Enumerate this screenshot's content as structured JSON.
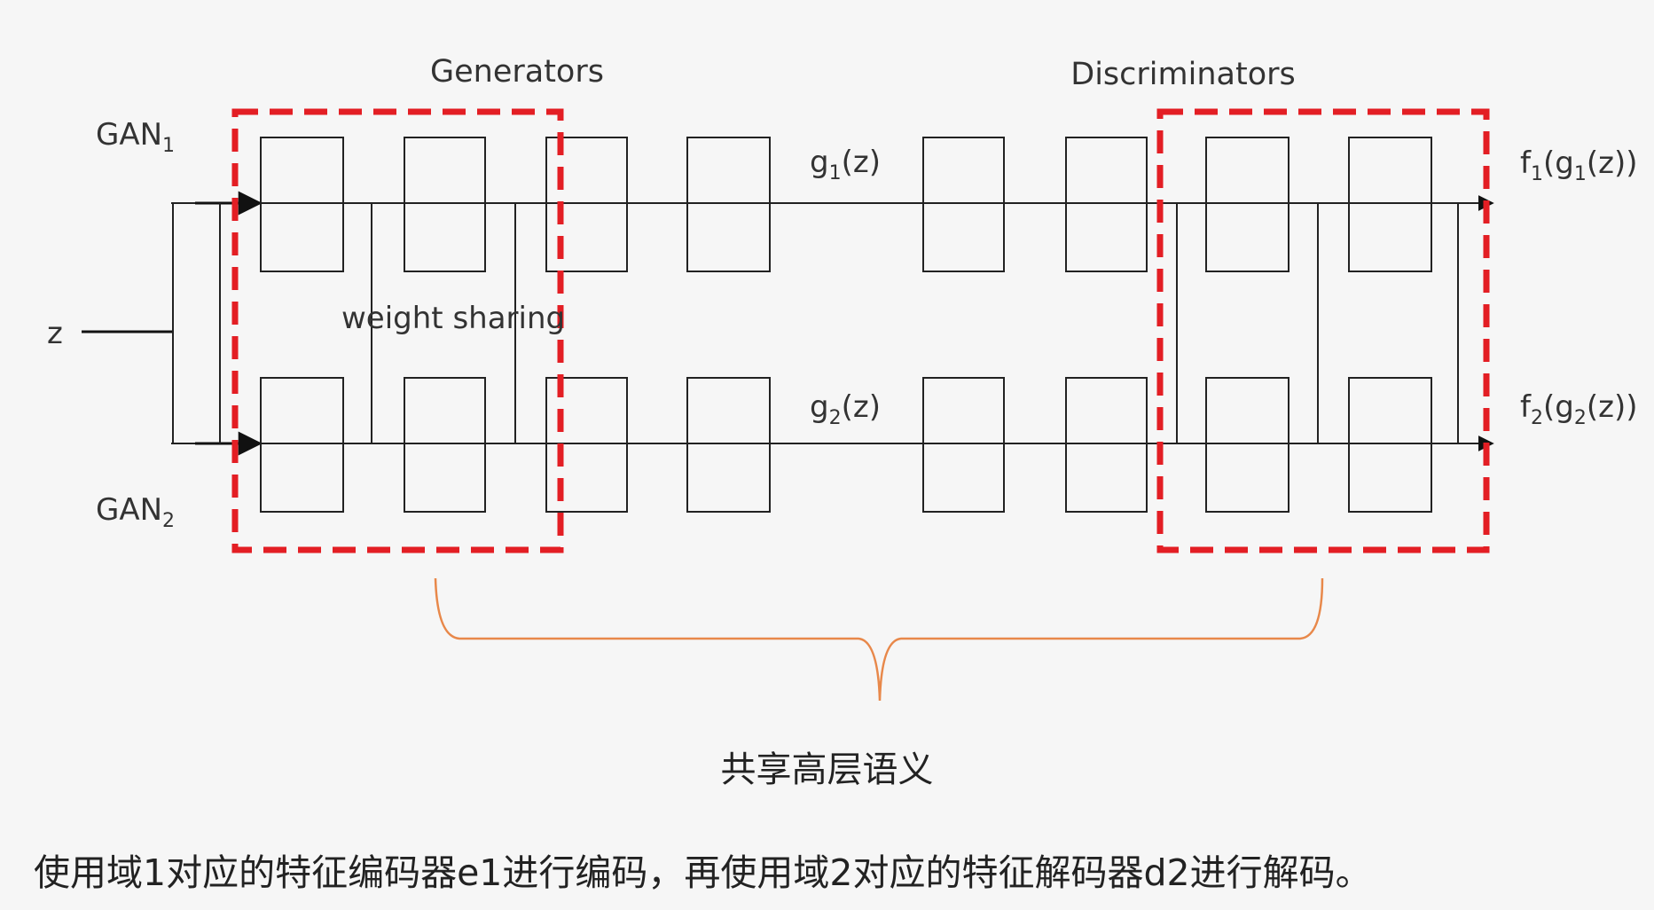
{
  "diagram": {
    "generators_label": "Generators",
    "discriminators_label": "Discriminators",
    "gan1": {
      "base": "GAN",
      "sub": "1"
    },
    "gan2": {
      "base": "GAN",
      "sub": "2"
    },
    "input_label": "z",
    "weight_sharing_label": "weight sharing",
    "g1": {
      "pre": "g",
      "sub": "1",
      "post": "(z)"
    },
    "g2": {
      "pre": "g",
      "sub": "2",
      "post": "(z)"
    },
    "f1": {
      "pre": "f",
      "sub1": "1",
      "mid": "(g",
      "sub2": "1",
      "post": "(z))"
    },
    "f2": {
      "pre": "f",
      "sub1": "2",
      "mid": "(g",
      "sub2": "2",
      "post": "(z))"
    },
    "shared_semantics_label": "共享高层语义",
    "colors": {
      "highlight": "#e31e24",
      "brace": "#e8884a",
      "line": "#222222",
      "background": "#f6f6f6"
    }
  },
  "footer_text": "使用域1对应的特征编码器e1进行编码，再使用域2对应的特征解码器d2进行解码。"
}
